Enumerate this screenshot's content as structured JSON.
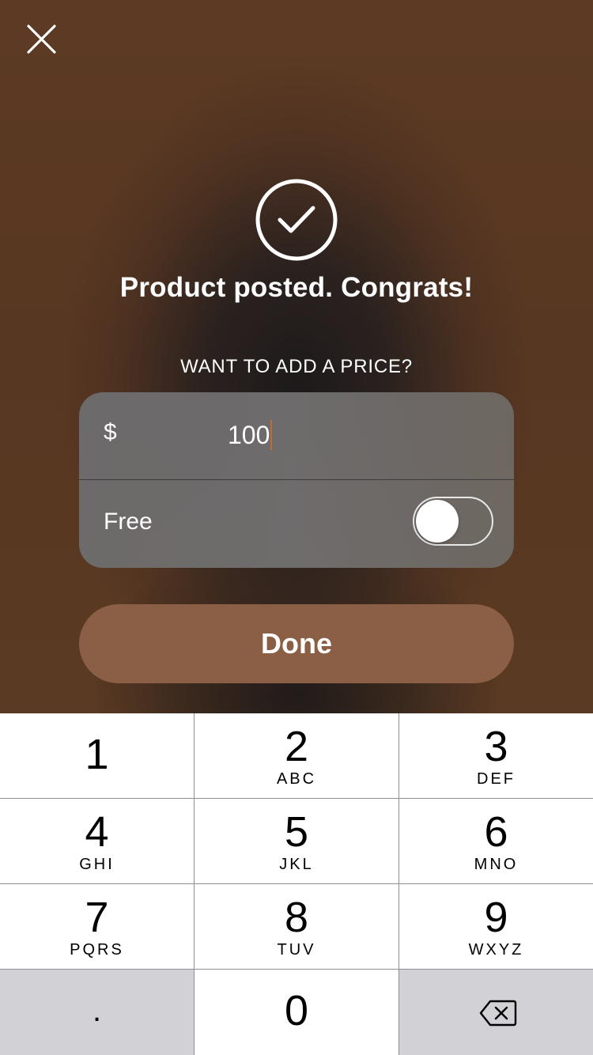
{
  "header": {
    "close_icon": "close-icon"
  },
  "success": {
    "icon": "checkmark-circle-icon",
    "title": "Product posted. Congrats!"
  },
  "price_form": {
    "prompt": "WANT TO ADD A PRICE?",
    "currency_symbol": "$",
    "price_value": "100",
    "free_label": "Free",
    "free_toggle_on": false
  },
  "actions": {
    "done_label": "Done"
  },
  "keypad": {
    "keys": [
      {
        "digit": "1",
        "letters": ""
      },
      {
        "digit": "2",
        "letters": "ABC"
      },
      {
        "digit": "3",
        "letters": "DEF"
      },
      {
        "digit": "4",
        "letters": "GHI"
      },
      {
        "digit": "5",
        "letters": "JKL"
      },
      {
        "digit": "6",
        "letters": "MNO"
      },
      {
        "digit": "7",
        "letters": "PQRS"
      },
      {
        "digit": "8",
        "letters": "TUV"
      },
      {
        "digit": "9",
        "letters": "WXYZ"
      }
    ],
    "decimal_key": ".",
    "zero_key": "0",
    "backspace_icon": "backspace-icon"
  },
  "colors": {
    "background_brown": "#5a3822",
    "done_button": "#8a5f45",
    "caret": "#c46a2e",
    "keypad_key": "#ffffff",
    "keypad_gray_key": "#d1d1d6"
  }
}
